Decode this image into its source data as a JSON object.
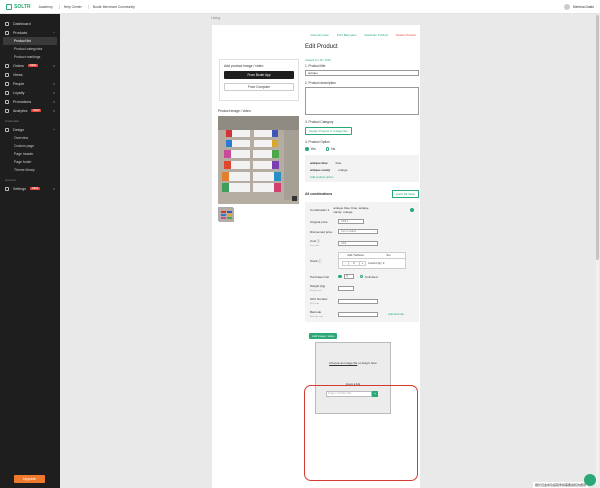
{
  "topbar": {
    "brand": "SOLTR",
    "nav": [
      "Academy",
      "Help Center",
      "Boutir Merchant Community"
    ],
    "user": "Melvina Dakis"
  },
  "sidebar": {
    "items": [
      {
        "label": "Dashboard"
      },
      {
        "label": "Products",
        "chevron": "^"
      },
      {
        "label": "Orders",
        "badge": "NEW",
        "chevron": "v"
      },
      {
        "label": "Views"
      },
      {
        "label": "People",
        "chevron": "v"
      },
      {
        "label": "Loyalty",
        "chevron": "v"
      },
      {
        "label": "Promotions",
        "chevron": "v"
      },
      {
        "label": "Analytics",
        "badge": "NEW",
        "chevron": "v"
      }
    ],
    "product_subitems": [
      "Product list",
      "Product categories",
      "Product markings"
    ],
    "section_customize": "Customize",
    "design": {
      "label": "Design",
      "chevron": "^"
    },
    "design_subitems": [
      "Overview",
      "Custom page",
      "Page header",
      "Page footer",
      "Theme library"
    ],
    "section_account": "Account",
    "settings": {
      "label": "Settings",
      "badge": "NEW",
      "chevron": "v"
    },
    "upgrade": "Upgrade"
  },
  "breadcrumb": "Listing",
  "actions": {
    "view_all": "View All Code",
    "preview": "Print Barcodes",
    "duplicate": "Duplicate Product",
    "delete": "Delete Product"
  },
  "page_title": "Edit Product",
  "add_media": {
    "title": "Add product image / video",
    "from_app": "From Boutir App",
    "from_computer": "From Computer"
  },
  "image_label": "Product image / video",
  "form": {
    "created": "Created 11 / 05 / 2024",
    "title_label": "1. Product title",
    "title_value": "antique",
    "description_label": "2. Product description",
    "category_label": "3. Product Category",
    "category_button": "Assign Product in Categories",
    "option_label": "4. Product Option",
    "option_yes": "Yes",
    "option_no": "No",
    "options": [
      {
        "name": "antique blue",
        "value": "blue"
      },
      {
        "name": "antique candy",
        "value": "orange"
      }
    ],
    "add_option": "Add product option"
  },
  "combinations": {
    "title": "All combinations",
    "quick_fill": "Quick Fill Value",
    "row_label": "Combination 1",
    "row_value": "antique blue: blue; antique candy: orange",
    "original_price_label": "Original price",
    "original_price_value": "HK$ 0",
    "discounted_price_label": "Discounted price",
    "discounted_price_value": "Not in usable",
    "cost_label": "Cost",
    "cost_sub": "Cost note",
    "cost_value": "HK$",
    "stock_label": "Stock",
    "stock_col1": "Add / Subtract",
    "stock_col2": "Set",
    "stock_minus": "-",
    "stock_value": "0",
    "stock_plus": "+",
    "stock_current": "Current Qty: 0",
    "purchase_limit_label": "Purchase limit",
    "purchase_limit_value": "0",
    "unlimited": "Unlimited",
    "weight_label": "Weight (kg)",
    "weight_sub": "Weight note",
    "sku_label": "SKU Number",
    "sku_sub": "SKU note",
    "barcode_label": "Barcode",
    "barcode_sub": "Barcode note",
    "barcode_link": "Add barcode"
  },
  "add_image": {
    "button": "Add image / video",
    "drop_text_link": "Choose an image file",
    "drop_text_rest": "or drag it here",
    "link_text": "Insert a link",
    "url_placeholder": "Image / YouTube URL",
    "url_submit": "+"
  },
  "toast": "關於資金成功提取申請需要審核的費用",
  "colors": {
    "brand": "#2aa876",
    "danger": "#d63b33",
    "upgrade": "#ef7a2b",
    "sidebar": "#1e1e1e"
  }
}
